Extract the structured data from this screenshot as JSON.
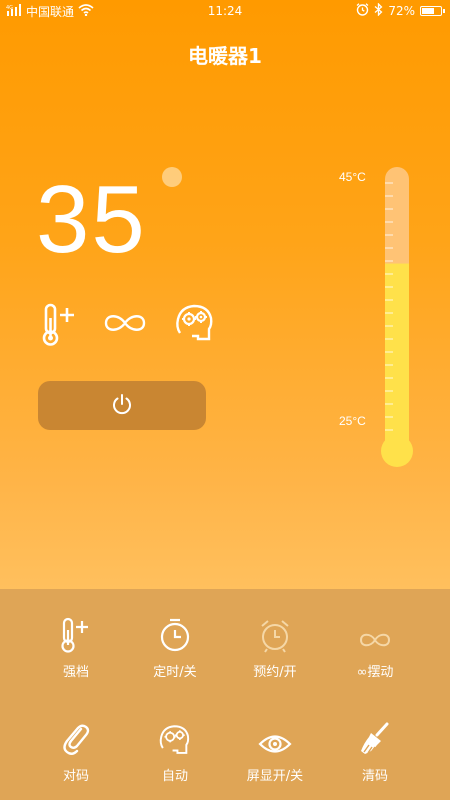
{
  "status_bar": {
    "carrier": "中国联通",
    "network_tag": "4G",
    "time": "11:24",
    "battery_text": "72%",
    "battery_level": 0.72,
    "icons": [
      "signal-icon",
      "wifi-icon",
      "alarm-icon",
      "bluetooth-icon",
      "battery-icon"
    ]
  },
  "header": {
    "title": "电暖器1"
  },
  "temperature": {
    "current": "35"
  },
  "mode_icons": [
    "thermometer-plus-icon",
    "infinity-icon",
    "gears-head-icon"
  ],
  "thermometer": {
    "max_label": "45°C",
    "min_label": "25°C",
    "fill_level": 0.66
  },
  "controls": [
    {
      "label": "强档",
      "icon": "thermometer-plus-icon"
    },
    {
      "label": "定时/关",
      "icon": "timer-icon"
    },
    {
      "label": "预约/开",
      "icon": "alarm-clock-icon"
    },
    {
      "label": "∞摆动",
      "icon": "infinity-icon"
    },
    {
      "label": "对码",
      "icon": "link-icon"
    },
    {
      "label": "自动",
      "icon": "gears-head-icon"
    },
    {
      "label": "屏显开/关",
      "icon": "eye-icon"
    },
    {
      "label": "清码",
      "icon": "broom-icon"
    }
  ],
  "colors": {
    "background_top": "#FF9A00",
    "background_bottom": "#FFC061",
    "panel": "#DFA556",
    "power_button": "#C98632",
    "thermometer_fill": "#FFE14A",
    "thermometer_track": "#FFC680"
  }
}
